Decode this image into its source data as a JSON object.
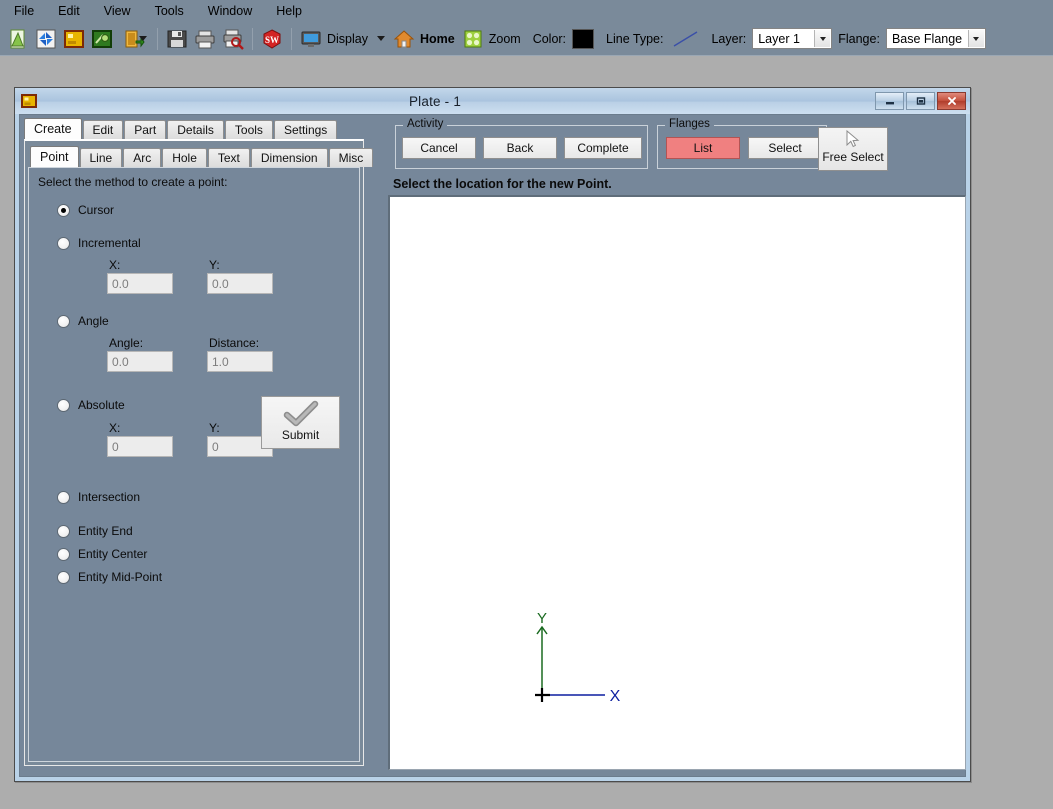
{
  "menu": {
    "items": [
      "File",
      "Edit",
      "View",
      "Tools",
      "Window",
      "Help"
    ]
  },
  "toolbar": {
    "icons": [
      {
        "name": "new-document-icon",
        "label": ""
      },
      {
        "name": "open-folder-icon",
        "label": ""
      },
      {
        "name": "plate-icon",
        "label": ""
      },
      {
        "name": "export-icon",
        "label": ""
      },
      {
        "name": "import-dropdown-icon",
        "label": ""
      },
      {
        "name": "save-icon",
        "label": ""
      },
      {
        "name": "print-icon",
        "label": ""
      },
      {
        "name": "print-preview-icon",
        "label": ""
      },
      {
        "name": "solidworks-icon",
        "label": ""
      }
    ],
    "display_label": "Display",
    "home_label": "Home",
    "zoom_label": "Zoom",
    "color_label": "Color:",
    "color_value": "#000000",
    "line_type_label": "Line Type:",
    "line_type_color": "#3a4fa8",
    "layer_label": "Layer:",
    "layer_value": "Layer 1",
    "flange_label": "Flange:",
    "flange_value": "Base Flange"
  },
  "window": {
    "title": "Plate - 1",
    "minimize_label": "Minimize",
    "restore_label": "Restore",
    "close_label": "Close"
  },
  "outer_tabs": [
    {
      "label": "Create",
      "active": true
    },
    {
      "label": "Edit",
      "active": false
    },
    {
      "label": "Part",
      "active": false
    },
    {
      "label": "Details",
      "active": false
    },
    {
      "label": "Tools",
      "active": false
    },
    {
      "label": "Settings",
      "active": false
    }
  ],
  "inner_tabs": [
    {
      "label": "Point",
      "active": true
    },
    {
      "label": "Line",
      "active": false
    },
    {
      "label": "Arc",
      "active": false
    },
    {
      "label": "Hole",
      "active": false
    },
    {
      "label": "Text",
      "active": false
    },
    {
      "label": "Dimension",
      "active": false
    },
    {
      "label": "Misc",
      "active": false
    }
  ],
  "form": {
    "hint": "Select the method to create a point:",
    "methods": [
      {
        "label": "Cursor",
        "selected": true
      },
      {
        "label": "Incremental",
        "selected": false
      },
      {
        "label": "Angle",
        "selected": false
      },
      {
        "label": "Absolute",
        "selected": false
      },
      {
        "label": "Intersection",
        "selected": false
      },
      {
        "label": "Entity End",
        "selected": false
      },
      {
        "label": "Entity Center",
        "selected": false
      },
      {
        "label": "Entity Mid-Point",
        "selected": false
      }
    ],
    "incremental": {
      "x_label": "X:",
      "x_value": "0.0",
      "y_label": "Y:",
      "y_value": "0.0"
    },
    "angle": {
      "angle_label": "Angle:",
      "angle_value": "0.0",
      "distance_label": "Distance:",
      "distance_value": "1.0"
    },
    "absolute": {
      "x_label": "X:",
      "x_value": "0",
      "y_label": "Y:",
      "y_value": "0"
    },
    "submit_label": "Submit"
  },
  "activity": {
    "title": "Activity",
    "cancel_label": "Cancel",
    "back_label": "Back",
    "complete_label": "Complete"
  },
  "flanges": {
    "title": "Flanges",
    "list_label": "List",
    "list_color": "#f08080",
    "select_label": "Select"
  },
  "free_select": {
    "label": "Free Select"
  },
  "status": {
    "text": "Select the location for the new Point."
  },
  "canvas": {
    "x_axis_label": "X",
    "x_axis_color": "#0d1fa0",
    "y_axis_label": "Y",
    "y_axis_color": "#1a6a20",
    "origin_color": "#000000"
  }
}
